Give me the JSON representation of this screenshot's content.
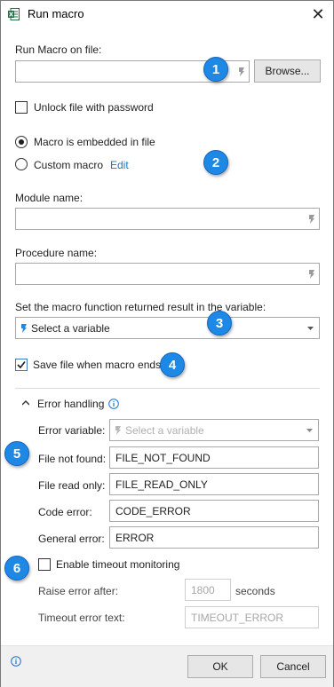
{
  "window": {
    "title": "Run macro",
    "close_glyph": "✕",
    "app_icon": "excel-icon"
  },
  "file": {
    "label": "Run Macro on file:",
    "value": "",
    "browse_label": "Browse..."
  },
  "unlock": {
    "label": "Unlock file with password",
    "checked": false
  },
  "macro_source": {
    "embedded_label": "Macro is embedded in file",
    "custom_label": "Custom macro",
    "edit_link": "Edit",
    "selected": "embedded"
  },
  "module": {
    "label": "Module name:",
    "value": ""
  },
  "procedure": {
    "label": "Procedure name:",
    "value": ""
  },
  "result": {
    "label": "Set the macro function returned result in the variable:",
    "placeholder": "Select a variable"
  },
  "save_file": {
    "label": "Save file when macro ends",
    "checked": true
  },
  "error_handling": {
    "header": "Error handling",
    "error_variable_label": "Error variable:",
    "error_variable_placeholder": "Select a variable",
    "file_not_found_label": "File not found:",
    "file_not_found_value": "FILE_NOT_FOUND",
    "file_read_only_label": "File read only:",
    "file_read_only_value": "FILE_READ_ONLY",
    "code_error_label": "Code error:",
    "code_error_value": "CODE_ERROR",
    "general_error_label": "General error:",
    "general_error_value": "ERROR",
    "timeout_label": "Enable timeout monitoring",
    "timeout_checked": false,
    "raise_after_label": "Raise error after:",
    "raise_after_value": "1800",
    "seconds_label": "seconds",
    "timeout_text_label": "Timeout error text:",
    "timeout_text_value": "TIMEOUT_ERROR"
  },
  "badges": [
    "1",
    "2",
    "3",
    "4",
    "5",
    "6"
  ],
  "footer": {
    "ok_label": "OK",
    "cancel_label": "Cancel"
  },
  "colors": {
    "accent": "#1e88e5",
    "link": "#1a73c8",
    "excel_green": "#1e7145"
  }
}
